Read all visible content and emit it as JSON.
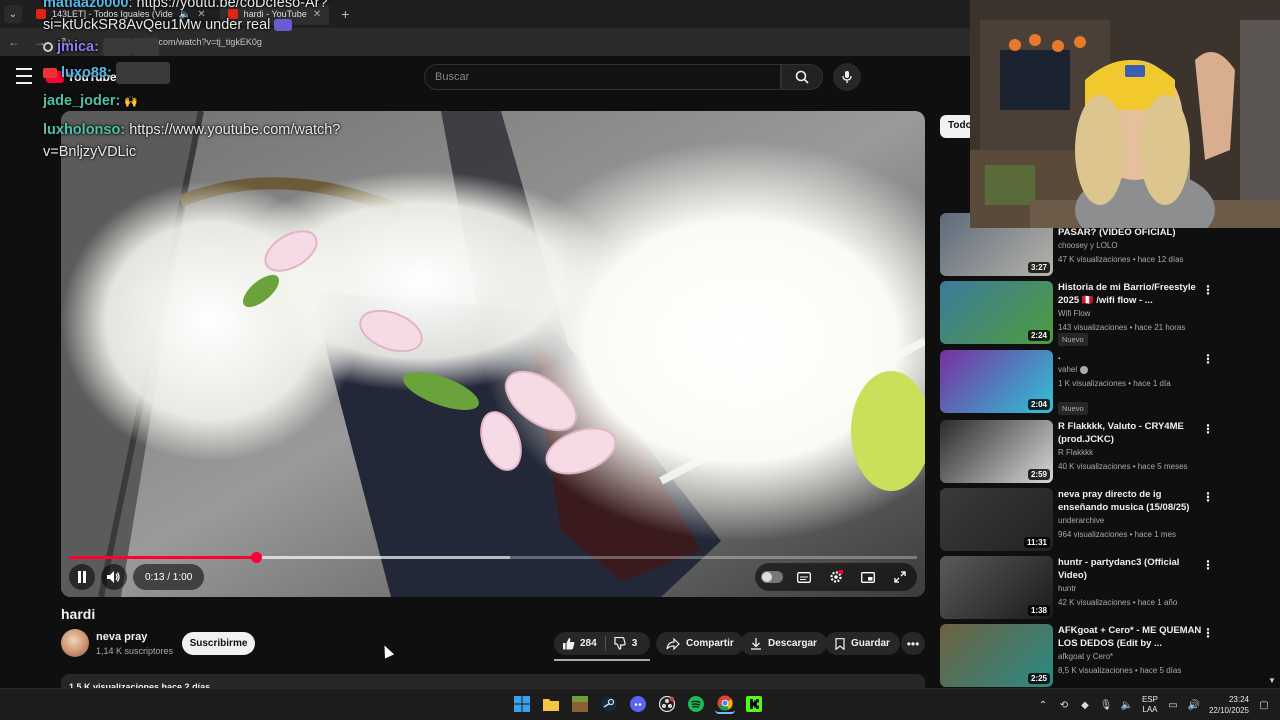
{
  "browser": {
    "tabs": [
      {
        "label": "143LET] - Todos Iguales (Vide"
      },
      {
        "label": "hardi - YouTube"
      }
    ],
    "url": "youtube.com/watch?v=tj_tigkEK0g"
  },
  "youtube": {
    "search_placeholder": "Buscar",
    "logo_text": "YouTube"
  },
  "chat": [
    {
      "user": "matiaaz0000",
      "message": "https://youtu.be/coDcIeso-Ar?si=ktUckSR8AvQeu1Mw under real",
      "color": "#53b8e8"
    },
    {
      "user": "jmica:",
      "message": "",
      "color": "#8f7cf1"
    },
    {
      "user": "luxo88:",
      "message": "",
      "color": "#53b8e8"
    },
    {
      "user": "jade_joder:",
      "message": "",
      "color": "#4fc1a6"
    },
    {
      "user": "luxholonso:",
      "message": "https://www.youtube.com/watch?v=BnljzyVDLic",
      "color": "#4fc1a6"
    }
  ],
  "player": {
    "time": "0:13 / 1:00",
    "progress": 0.22,
    "buffered": 0.52,
    "progress_color": "#ff0033"
  },
  "video": {
    "title": "hardi",
    "channel": "neva pray",
    "subscribers": "1,14 K suscriptores",
    "subscribe_label": "Suscribirme",
    "likes": "284",
    "dislikes": "3",
    "share_label": "Compartir",
    "download_label": "Descargar",
    "save_label": "Guardar",
    "description_stats": "1,5 K visualizaciones  hace 2 días"
  },
  "sidebar": {
    "chip": "Todo",
    "recommendations": [
      {
        "title": "LOLO, CHOOSEY - QUÉ PUEDE PASAR? (VIDEO OFICIAL)",
        "channel": "choosey y LOLO",
        "meta": "47 K visualizaciones • hace 12 días",
        "duration": "3:27",
        "badge": ""
      },
      {
        "title": "Historia de mi Barrio/Freestyle 2025 🇵🇪 /wifi flow - ...",
        "channel": "Wifi Flow",
        "meta": "143 visualizaciones • hace 21 horas",
        "duration": "2:24",
        "badge": "Nuevo"
      },
      {
        "title": ".",
        "channel": "vahel",
        "meta": "1 K visualizaciones • hace 1 día",
        "duration": "2:04",
        "badge": "Nuevo"
      },
      {
        "title": "R Flakkkk, Valuto - CRY4ME (prod.JCKC)",
        "channel": "R Flakkkk",
        "meta": "40 K visualizaciones • hace 5 meses",
        "duration": "2:59",
        "badge": ""
      },
      {
        "title": "neva pray directo de ig enseñando musica (15/08/25)",
        "channel": "underarchive",
        "meta": "964 visualizaciones • hace 1 mes",
        "duration": "11:31",
        "badge": ""
      },
      {
        "title": "huntr - partydanc3 (Official Video)",
        "channel": "huntr",
        "meta": "42 K visualizaciones • hace 1 año",
        "duration": "1:38",
        "badge": ""
      },
      {
        "title": "AFKgoat + Cero* - ME QUEMAN LOS DEDOS (Edit by ...",
        "channel": "afkgoat y Cero*",
        "meta": "8,5 K visualizaciones • hace 5 días",
        "duration": "2:25",
        "badge": ""
      }
    ]
  },
  "taskbar": {
    "lang_top": "ESP",
    "lang_bottom": "LAA",
    "time": "23:24",
    "date": "22/10/2025"
  }
}
